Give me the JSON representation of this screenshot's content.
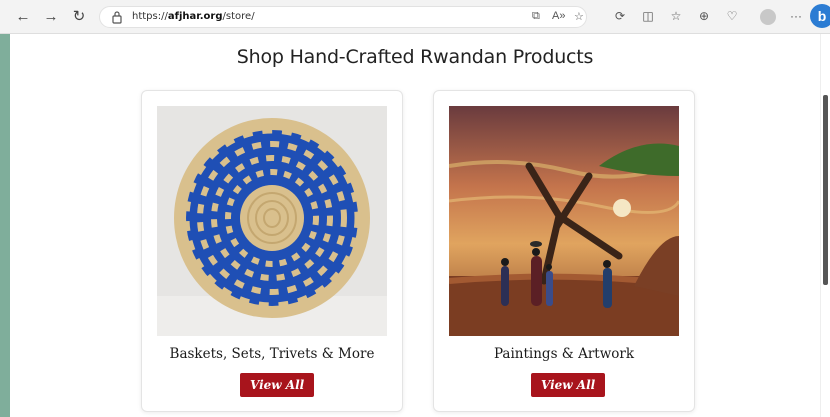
{
  "browser": {
    "url_prefix": "https://",
    "url_domain": "afjhar.org",
    "url_path": "/store/",
    "bing_label": "b"
  },
  "page": {
    "heading": "Shop Hand-Crafted Rwandan Products"
  },
  "products": [
    {
      "title": "Baskets, Sets, Trivets & More",
      "button": "View All",
      "image": "basket-image"
    },
    {
      "title": "Paintings & Artwork",
      "button": "View All",
      "image": "painting-image"
    }
  ],
  "colors": {
    "accent": "#a8141c",
    "basket_blue": "#1f4fb5",
    "basket_tan": "#d9c08d"
  }
}
